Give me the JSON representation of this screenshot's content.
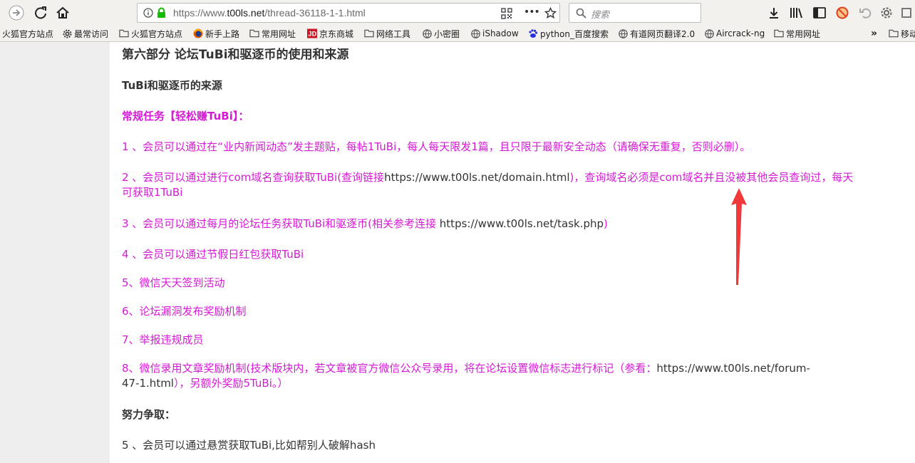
{
  "browser": {
    "url_prefix": "https://www.",
    "url_domain": "t00ls.net",
    "url_path": "/thread-36118-1-1.html",
    "search_placeholder": "搜索",
    "more_label": "•••"
  },
  "bookmarks": [
    {
      "label": "火狐官方站点",
      "icon": "none"
    },
    {
      "label": "最常访问",
      "icon": "gear-icon"
    },
    {
      "label": "火狐官方站点",
      "icon": "folder-icon"
    },
    {
      "label": "新手上路",
      "icon": "firefox-icon"
    },
    {
      "label": "常用网址",
      "icon": "folder-icon"
    },
    {
      "label": "京东商城",
      "icon": "jd-icon"
    },
    {
      "label": "网络工具",
      "icon": "folder-icon"
    },
    {
      "label": "小密圈",
      "icon": "globe-icon"
    },
    {
      "label": "iShadow",
      "icon": "globe-icon"
    },
    {
      "label": "python_百度搜索",
      "icon": "baidu-icon"
    },
    {
      "label": "有道网页翻译2.0",
      "icon": "globe-icon"
    },
    {
      "label": "Aircrack-ng",
      "icon": "globe-icon"
    },
    {
      "label": "常用网址",
      "icon": "folder-icon"
    },
    {
      "label": "移动",
      "icon": "folder-icon"
    }
  ],
  "article": {
    "heading": "第六部分 论坛TuBi和驱逐币的使用和来源",
    "subheading": "TuBi和驱逐币的来源",
    "section_title": "常规任务【轻松赚TuBi】：",
    "item1": "1 、会员可以通过在“业内新闻动态”发主题贴，每帖1TuBi，每人每天限发1篇，且只限于最新安全动态（请确保无重复，否则必删）。",
    "item2_a": "2 、会员可以通过进行com域名查询获取TuBi(查询链接",
    "item2_link": "https://www.t00ls.net/domain.html",
    "item2_b": ")，查询域名必须是com域名并且没被其他会员查询过，每天",
    "item2_c": "可获取1TuBi",
    "item3_a": "3 、会员可以通过每月的论坛任务获取TuBi和驱逐币(相关参考连接 ",
    "item3_link": "https://www.t00ls.net/task.php",
    "item3_b": ")",
    "item4": "4 、会员可以通过节假日红包获取TuBi",
    "item5": "5、微信天天签到活动",
    "item6": "6、论坛漏洞发布奖励机制",
    "item7": "7、举报违规成员",
    "item8_a": "8、微信录用文章奖励机制(技术版块内，若文章被官方微信公众号录用，将在论坛设置微信标志进行标记（参看：",
    "item8_link1": "https://www.t00ls.net/forum-",
    "item8_link2": "47-1.html",
    "item8_b": "），另额外奖励5TuBi。）",
    "effort_title": "努力争取：",
    "effort1": "5 、会员可以通过悬赏获取TuBi,比如帮别人破解hash"
  },
  "colors": {
    "pink": "#d51ad5",
    "text": "#333333",
    "arrow": "#f03a3a"
  }
}
